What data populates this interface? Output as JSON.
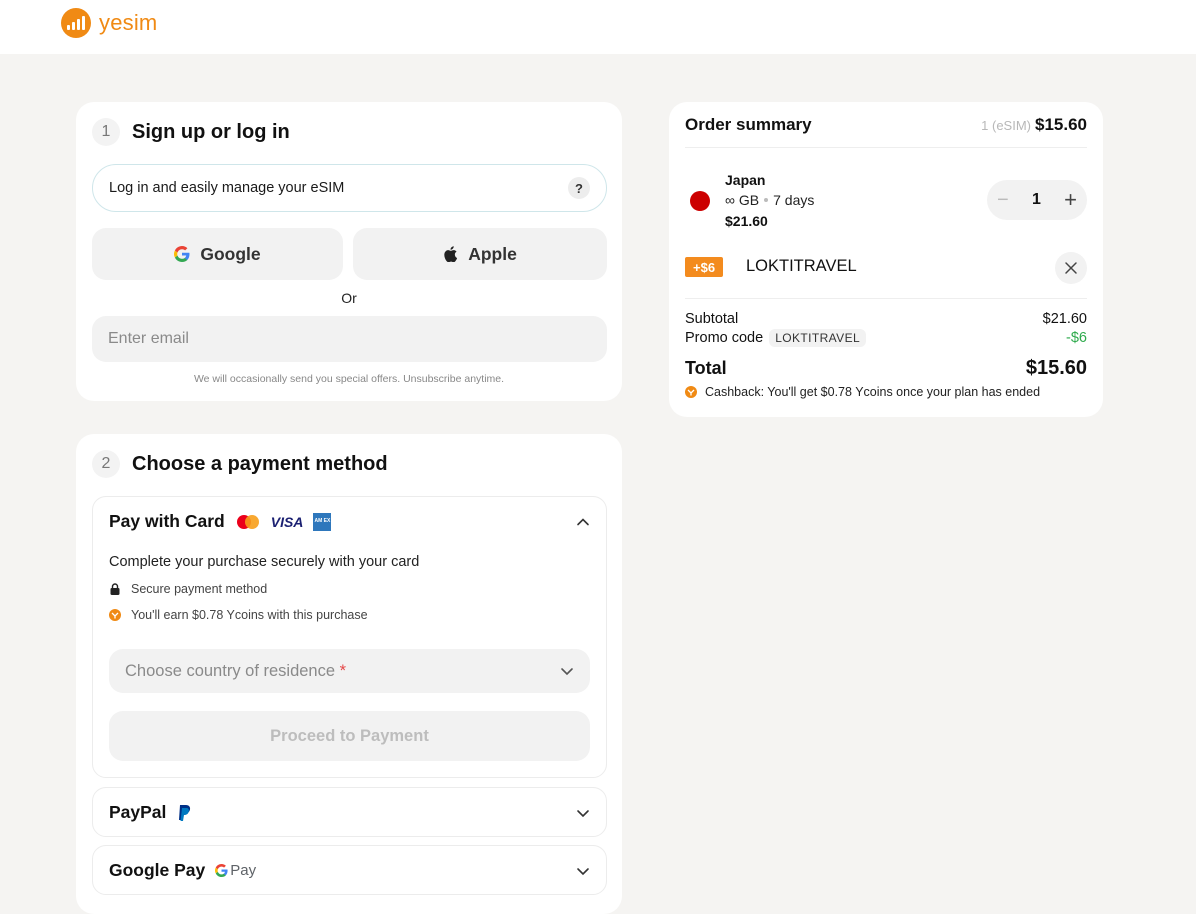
{
  "brand": {
    "name": "yesim"
  },
  "signup": {
    "step_number": "1",
    "title": "Sign up or log in",
    "info_text": "Log in and easily manage your eSIM",
    "info_icon": "?",
    "google_label": "Google",
    "apple_label": "Apple",
    "or_text": "Or",
    "email_placeholder": "Enter email",
    "fine_print": "We will occasionally send you special offers. Unsubscribe anytime."
  },
  "payment": {
    "step_number": "2",
    "title": "Choose a payment method",
    "card": {
      "label": "Pay with Card",
      "visa_text": "VISA",
      "amex_text": "AM EX",
      "description": "Complete your purchase securely with your card",
      "features": [
        "Secure payment method",
        "You'll earn $0.78 Ycoins with this purchase"
      ],
      "country_placeholder": "Choose country of residence",
      "required_mark": "*",
      "proceed_label": "Proceed to Payment"
    },
    "paypal_label": "PayPal",
    "googlepay_label": "Google Pay",
    "gpay_logo_text": "Pay"
  },
  "order": {
    "title": "Order summary",
    "count_label": "1 (eSIM)",
    "total_header": "$15.60",
    "item": {
      "name": "Japan",
      "data": "∞ GB",
      "duration": "7 days",
      "price": "$21.60",
      "quantity": "1"
    },
    "promo": {
      "badge": "+$6",
      "code": "LOKTITRAVEL"
    },
    "subtotal_label": "Subtotal",
    "subtotal_value": "$21.60",
    "promo_label": "Promo code",
    "promo_tag": "LOKTITRAVEL",
    "promo_value": "-$6",
    "total_label": "Total",
    "total_value": "$15.60",
    "cashback": "Cashback: You'll get $0.78 Ycoins once your plan has ended"
  },
  "colors": {
    "brand_orange": "#f08a14",
    "promo_orange": "#f38b1e",
    "discount_green": "#2eaa4c",
    "japan_red": "#cc0000"
  }
}
